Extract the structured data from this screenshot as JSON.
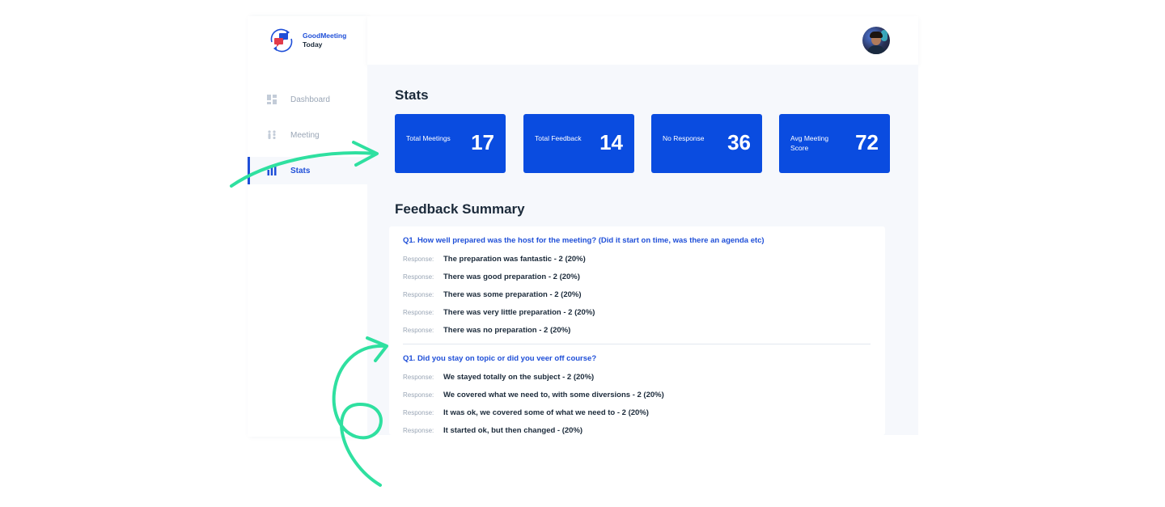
{
  "brand": {
    "line1": "GoodMeeting",
    "line2": "Today",
    "accent": "#1f4fd8",
    "red": "#e23b4a"
  },
  "sidebar": {
    "items": [
      {
        "label": "Dashboard",
        "icon": "dashboard-icon",
        "active": false
      },
      {
        "label": "Meeting",
        "icon": "meeting-icon",
        "active": false
      },
      {
        "label": "Stats",
        "icon": "bar-chart-icon",
        "active": true
      }
    ]
  },
  "header": {
    "avatar": "user-avatar"
  },
  "stats": {
    "title": "Stats",
    "cards": [
      {
        "label": "Total Meetings",
        "value": "17"
      },
      {
        "label": "Total Feedback",
        "value": "14"
      },
      {
        "label": "No Response",
        "value": "36"
      },
      {
        "label": "Avg Meeting Score",
        "value": "72"
      }
    ],
    "card_color": "#0a4ce0"
  },
  "feedback": {
    "title": "Feedback Summary",
    "response_label": "Response:",
    "questions": [
      {
        "question": "Q1. How well prepared was the host for the meeting? (Did it start on time, was there an agenda etc)",
        "responses": [
          "The preparation was fantastic - 2  (20%)",
          "There was good preparation  - 2 (20%)",
          "There was some preparation - 2 (20%)",
          "There was very little preparation - 2 (20%)",
          "There was no preparation - 2 (20%)"
        ]
      },
      {
        "question": "Q1. Did you stay on topic or did you veer off course?",
        "responses": [
          "We stayed totally on the subject - 2  (20%)",
          "We covered what we need to, with some diversions - 2 (20%)",
          "It was ok, we covered some of what we need to - 2 (20%)",
          "It started ok, but then changed - (20%)"
        ]
      }
    ]
  },
  "decor_color": "#2fe0a0"
}
